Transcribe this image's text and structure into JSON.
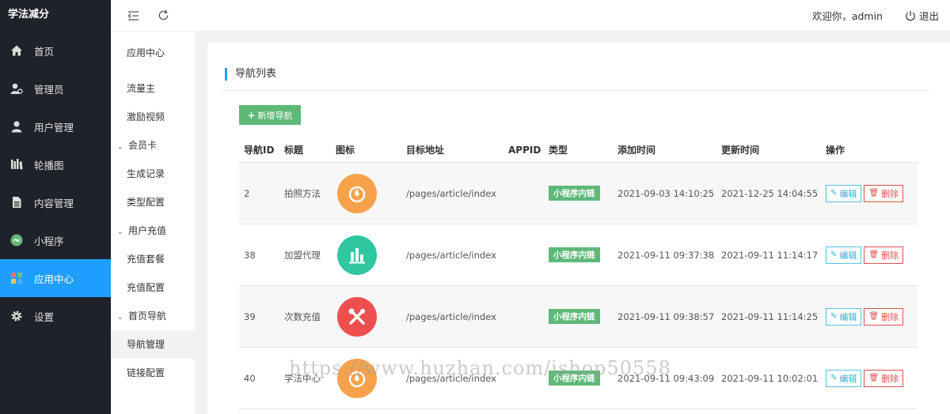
{
  "app": {
    "title": "学法减分"
  },
  "sidebar": {
    "items": [
      {
        "label": "首页",
        "icon": "home-icon"
      },
      {
        "label": "管理员",
        "icon": "admin-icon"
      },
      {
        "label": "用户管理",
        "icon": "user-icon"
      },
      {
        "label": "轮播图",
        "icon": "carousel-icon"
      },
      {
        "label": "内容管理",
        "icon": "document-icon"
      },
      {
        "label": "小程序",
        "icon": "miniprogram-icon"
      },
      {
        "label": "应用中心",
        "icon": "app-grid-icon",
        "active": true
      },
      {
        "label": "设置",
        "icon": "gear-icon"
      }
    ]
  },
  "subnav": {
    "header": "应用中心",
    "traffic": "流量主",
    "video": "激励视频",
    "member_card": "会员卡",
    "gen_records": "生成记录",
    "type_config": "类型配置",
    "user_recharge": "用户充值",
    "recharge_pkg": "充值套餐",
    "recharge_config": "充值配置",
    "home_nav": "首页导航",
    "nav_manage": "导航管理",
    "link_config": "链接配置"
  },
  "topbar": {
    "welcome": "欢迎你，admin",
    "logout": "退出"
  },
  "panel": {
    "title": "导航列表",
    "add_button": "新增导航"
  },
  "table": {
    "headers": {
      "id": "导航ID",
      "title": "标题",
      "icon": "图标",
      "url": "目标地址",
      "appid": "APPID",
      "type": "类型",
      "added": "添加时间",
      "updated": "更新时间",
      "ops": "操作"
    },
    "edit_label": "编辑",
    "delete_label": "删除",
    "rows": [
      {
        "id": "2",
        "title": "拍照方法",
        "icon": "camera-drop-icon",
        "icon_color": "#f7a24b",
        "url": "/pages/article/index",
        "appid": "",
        "type": "小程序内链",
        "added": "2021-09-03 14:10:25",
        "updated": "2021-12-25 14:04:55"
      },
      {
        "id": "38",
        "title": "加盟代理",
        "icon": "bar-chart-icon",
        "icon_color": "#2fc6a0",
        "url": "/pages/article/index",
        "appid": "",
        "type": "小程序内链",
        "added": "2021-09-11 09:37:38",
        "updated": "2021-09-11 11:14:17"
      },
      {
        "id": "39",
        "title": "次数充值",
        "icon": "tools-icon",
        "icon_color": "#ee4e4e",
        "url": "/pages/article/index",
        "appid": "",
        "type": "小程序内链",
        "added": "2021-09-11 09:38:57",
        "updated": "2021-09-11 11:14:25"
      },
      {
        "id": "40",
        "title": "学法中心",
        "icon": "camera-drop-icon",
        "icon_color": "#f7a24b",
        "url": "/pages/article/index",
        "appid": "",
        "type": "小程序内链",
        "added": "2021-09-11 09:43:09",
        "updated": "2021-09-11 10:02:01"
      }
    ]
  },
  "watermark": "https://www.huzhan.com/ishop50558"
}
